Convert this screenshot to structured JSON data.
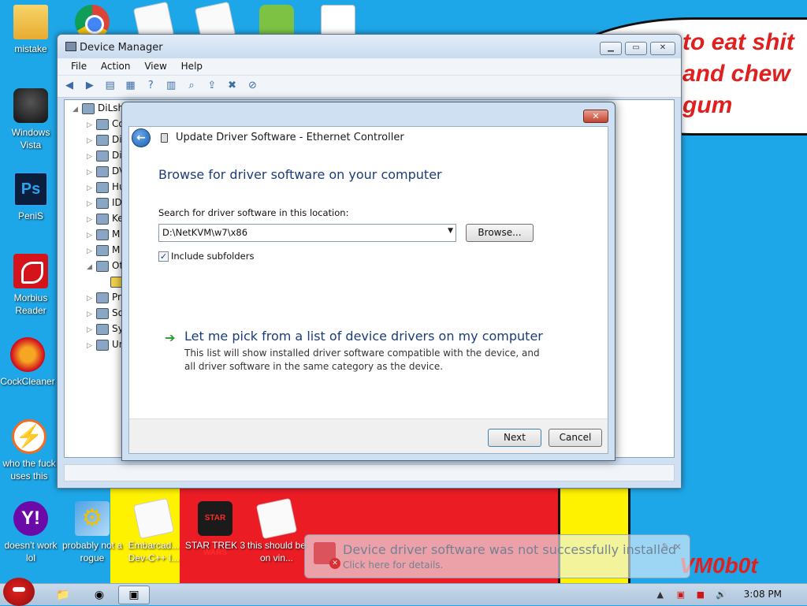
{
  "desktop": {
    "speech_text": "to eat shit and chew gum",
    "watermark": "VM0b0t",
    "icons": [
      {
        "label": "mistake",
        "icon": "folder-icon"
      },
      {
        "label": "Windows Vista",
        "icon": "vista-icon"
      },
      {
        "label": "PeniS",
        "icon": "photoshop-icon"
      },
      {
        "label": "Morbius Reader",
        "icon": "pdf-reader-icon"
      },
      {
        "label": "CockCleaner",
        "icon": "ccleaner-icon"
      },
      {
        "label": "who the fuck uses this",
        "icon": "bolt-icon"
      },
      {
        "label": "doesn't work lol",
        "icon": "yahoo-icon"
      },
      {
        "label": "probably not a rogue",
        "icon": "tools-icon"
      },
      {
        "label": "Embarcad... Dev-C++ I...",
        "icon": "document-icon"
      },
      {
        "label": "STAR TREK 3",
        "icon": "star-trek-icon"
      },
      {
        "label": "this should be on vin...",
        "icon": "document-icon"
      }
    ]
  },
  "device_manager": {
    "title": "Device Manager",
    "menu": [
      "File",
      "Action",
      "View",
      "Help"
    ],
    "tree_root": "DiLsh",
    "tree_items": [
      "Co",
      "Di",
      "Di",
      "DV",
      "Hu",
      "ID",
      "Ke",
      "M",
      "M",
      "Ot",
      "Pr",
      "So",
      "Sy",
      "Un"
    ]
  },
  "dialog": {
    "title": "Update Driver Software - Ethernet Controller",
    "headline": "Browse for driver software on your computer",
    "search_label": "Search for driver software in this location:",
    "path_value": "D:\\NetKVM\\w7\\x86",
    "browse_label": "Browse...",
    "include_subfolders_label": "Include subfolders",
    "include_subfolders_checked": true,
    "pick_title": "Let me pick from a list of device drivers on my computer",
    "pick_desc": "This list will show installed driver software compatible with the device, and all driver software in the same category as the device.",
    "next_label": "Next",
    "cancel_label": "Cancel"
  },
  "balloon": {
    "title": "Device driver software was not successfully installed",
    "subtitle": "Click here for details."
  },
  "taskbar": {
    "clock": "3:08 PM"
  }
}
